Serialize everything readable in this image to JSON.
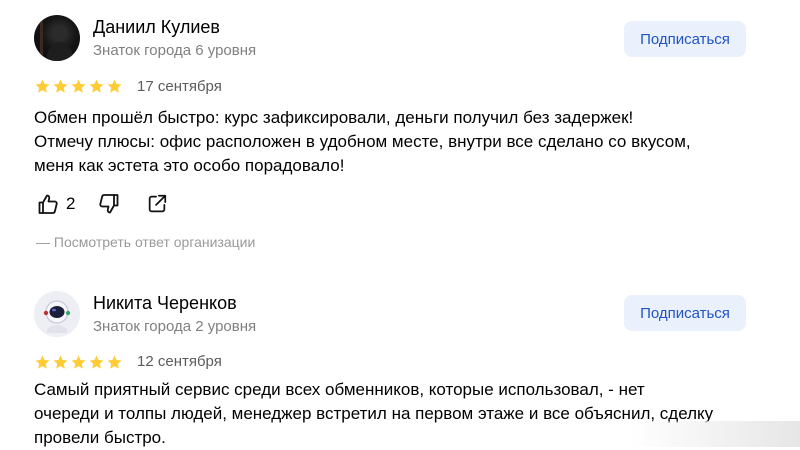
{
  "colors": {
    "star": "#fc3",
    "subscribe_bg": "#ebf1fc",
    "subscribe_text": "#1f53c6",
    "muted_text": "#808080"
  },
  "reviews": [
    {
      "author": "Даниил Кулиев",
      "level": "Знаток города 6 уровня",
      "subscribe_label": "Подписаться",
      "rating": 5,
      "date": "17 сентября",
      "text_lines": [
        "Обмен прошёл быстро: курс зафиксировали, деньги получил без задержек!",
        "Отмечу плюсы: офис расположен в удобном месте, внутри все сделано со вкусом,",
        "меня как эстета это особо порадовало!"
      ],
      "likes": "2",
      "org_answer_link": "— Посмотреть ответ организации",
      "icons": [
        "thumbs-up-icon",
        "thumbs-down-icon",
        "share-icon"
      ]
    },
    {
      "author": "Никита Черенков",
      "level": "Знаток города 2 уровня",
      "subscribe_label": "Подписаться",
      "rating": 5,
      "date": "12 сентября",
      "text_lines": [
        "Самый приятный сервис среди всех обменников, которые использовал, - нет",
        "очереди и толпы людей, менеджер встретил на первом этаже и все объяснил, сделку",
        "провели быстро."
      ]
    }
  ]
}
